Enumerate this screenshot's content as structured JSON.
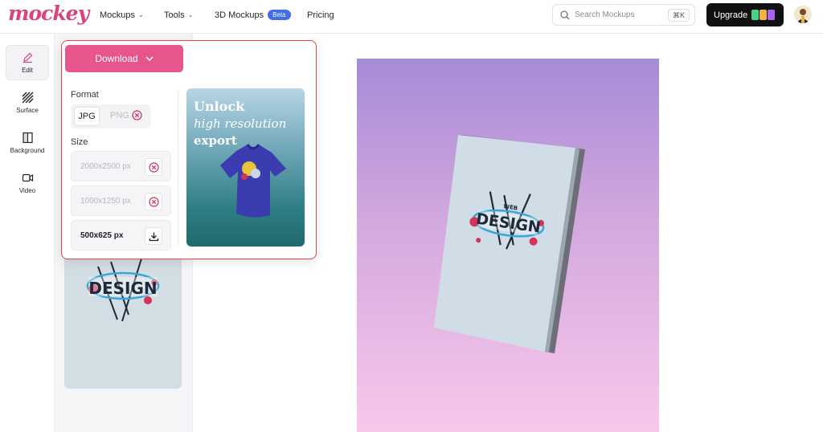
{
  "brand": {
    "logo_text": "mockey",
    "accent": "#d9437e"
  },
  "nav": {
    "items": [
      {
        "label": "Mockups",
        "has_dropdown": true
      },
      {
        "label": "Tools",
        "has_dropdown": true
      },
      {
        "label": "3D Mockups",
        "badge": "Beta"
      },
      {
        "label": "Pricing"
      }
    ]
  },
  "search": {
    "placeholder": "Search Mockups",
    "shortcut": "⌘K"
  },
  "upgrade": {
    "label": "Upgrade"
  },
  "sidebar": {
    "items": [
      {
        "label": "Edit",
        "icon": "pencil-icon",
        "active": true
      },
      {
        "label": "Surface",
        "icon": "hatch-icon"
      },
      {
        "label": "Background",
        "icon": "background-icon"
      },
      {
        "label": "Video",
        "icon": "video-camera-icon"
      }
    ]
  },
  "download_popup": {
    "button_label": "Download",
    "format_label": "Format",
    "formats": [
      {
        "label": "JPG",
        "selected": true,
        "available": true
      },
      {
        "label": "PNG",
        "selected": false,
        "available": false
      }
    ],
    "size_label": "Size",
    "sizes": [
      {
        "label": "2000x2500 px",
        "available": false
      },
      {
        "label": "1000x1250 px",
        "available": false
      },
      {
        "label": "500x625 px",
        "available": true
      }
    ],
    "promo": {
      "line1": "Unlock",
      "line2": "high resolution",
      "line3": "export"
    }
  },
  "artwork": {
    "main_word": "DESIGN",
    "small_word": "WEB"
  },
  "colors": {
    "download_button": "#e8558c",
    "popup_border": "#e64545",
    "beta_badge": "#3f6ee8"
  }
}
